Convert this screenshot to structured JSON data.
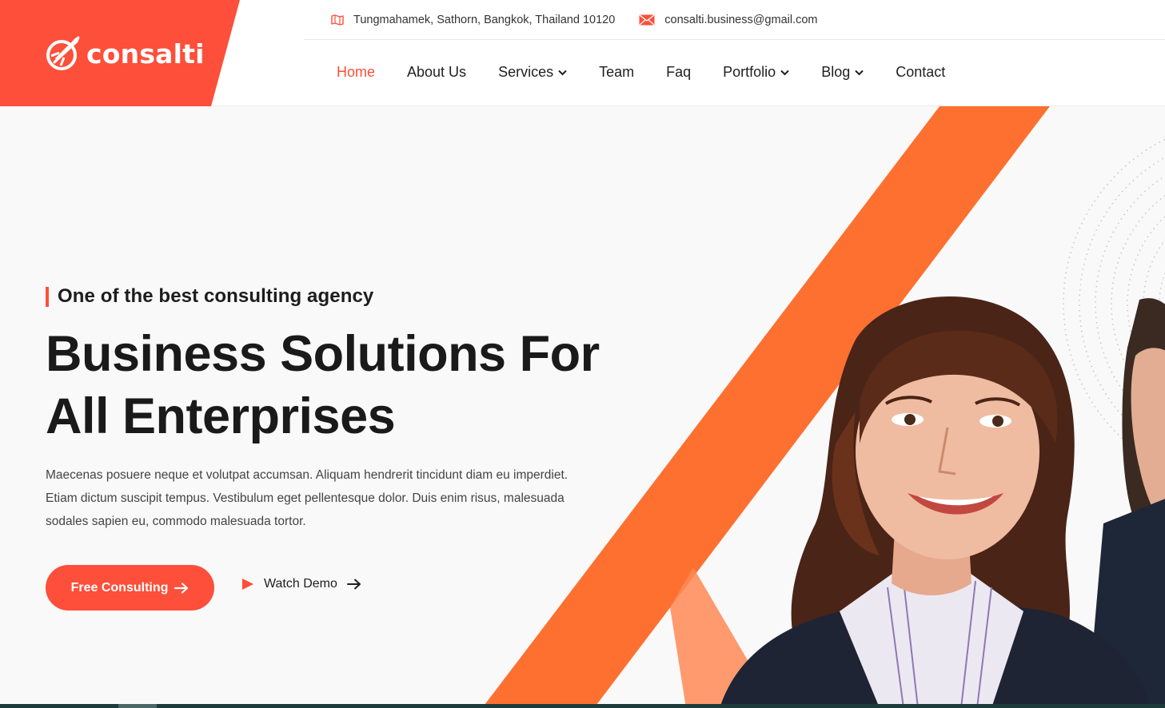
{
  "brand": {
    "name": "consalti",
    "color": "#fd4f39"
  },
  "topbar": {
    "address": "Tungmahamek, Sathorn, Bangkok, Thailand 10120",
    "address_icon": "map-icon",
    "email": "consalti.business@gmail.com",
    "email_icon": "envelope-icon"
  },
  "nav": {
    "items": [
      {
        "label": "Home",
        "active": true
      },
      {
        "label": "About Us"
      },
      {
        "label": "Services",
        "dropdown": true
      },
      {
        "label": "Team"
      },
      {
        "label": "Faq"
      },
      {
        "label": "Portfolio",
        "dropdown": true
      },
      {
        "label": "Blog",
        "dropdown": true
      },
      {
        "label": "Contact"
      }
    ]
  },
  "hero": {
    "eyebrow": "One of the best consulting agency",
    "title_line1": "Business Solutions For",
    "title_line2": "All Enterprises",
    "description": "Maecenas posuere neque et volutpat accumsan. Aliquam hendrerit tincidunt diam eu imperdiet. Etiam dictum suscipit tempus. Vestibulum eget pellentesque dolor. Duis enim risus, malesuada sodales sapien eu, commodo malesuada tortor.",
    "primary_button": "Free Consulting",
    "secondary_button": "Watch Demo"
  },
  "colors": {
    "accent": "#fd4f39",
    "stripe": "#fe7030",
    "dark": "#1a1a1a"
  }
}
